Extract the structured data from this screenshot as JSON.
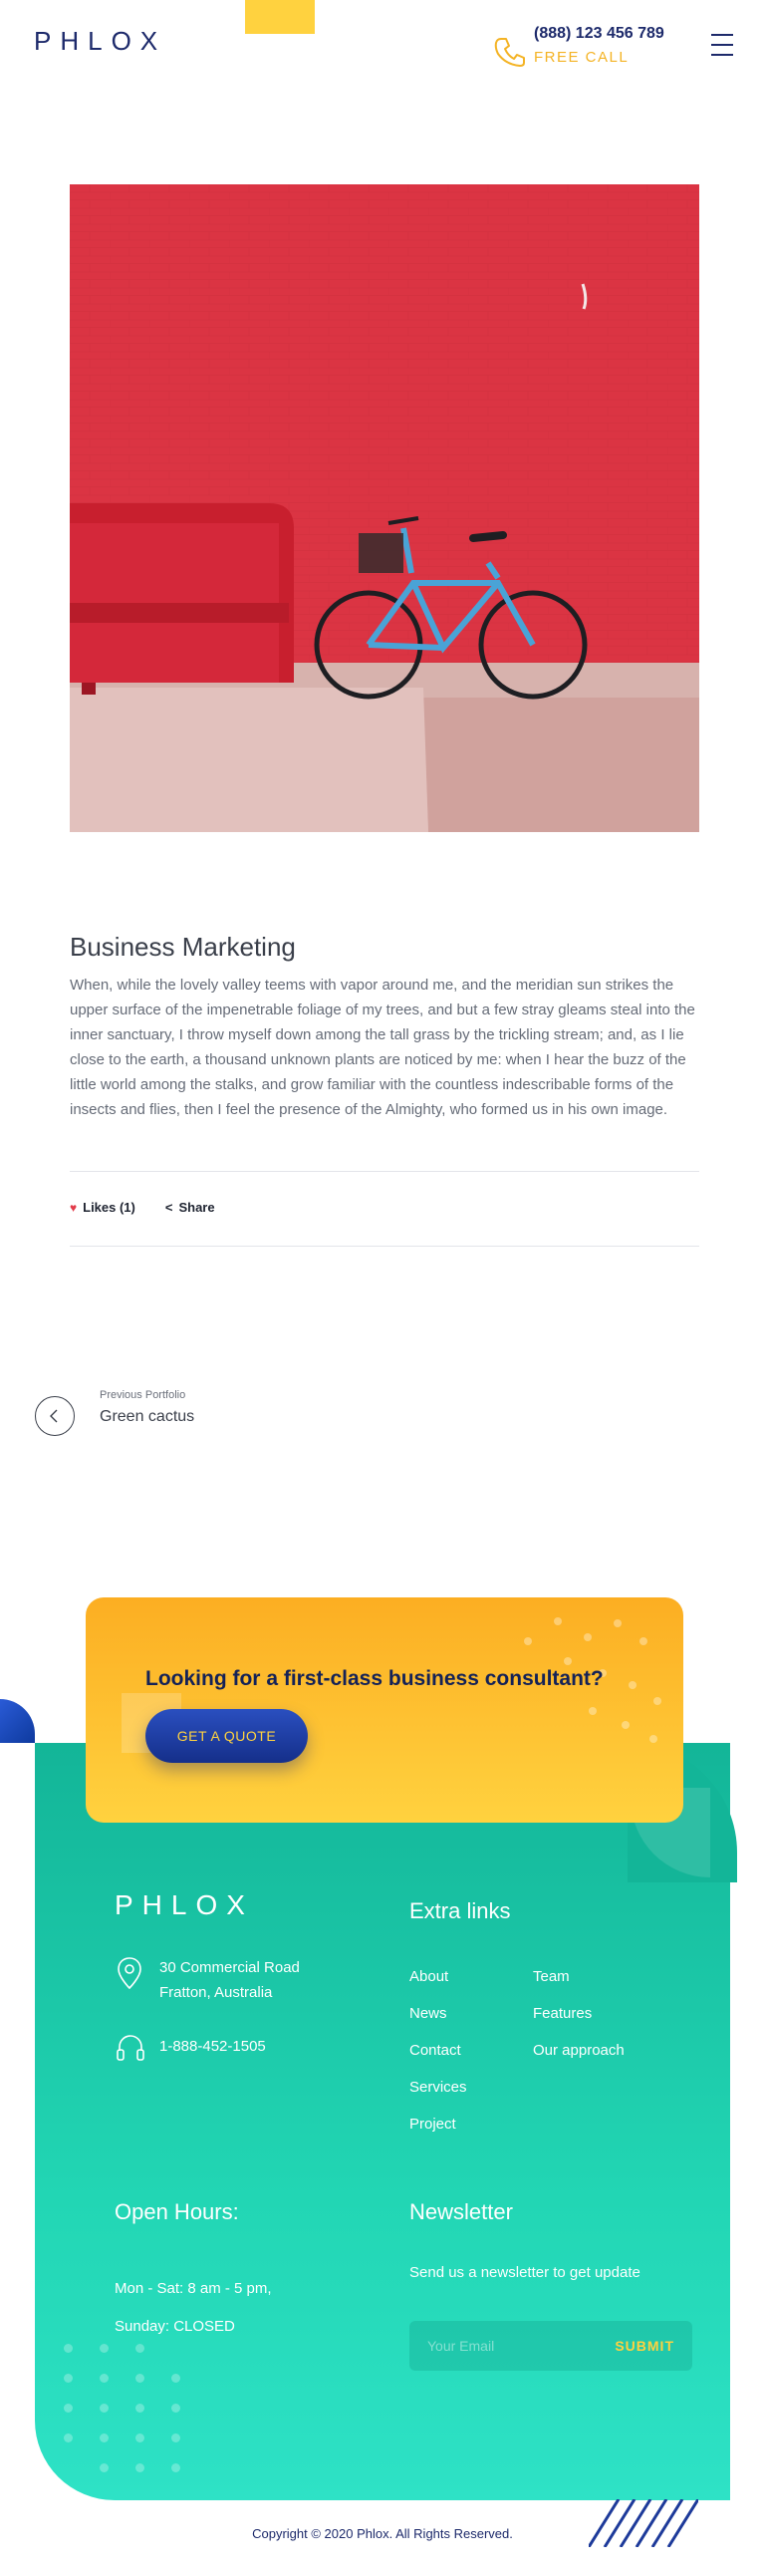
{
  "header": {
    "logo": "PHLOX",
    "phone_number": "(888) 123 456 789",
    "free_call": "FREE CALL",
    "menu_icon": "hamburger-menu-icon",
    "phone_icon": "phone-icon"
  },
  "article": {
    "title": "Business Marketing",
    "body": "When, while the lovely valley teems with vapor around me, and the meridian sun strikes the upper surface of the impenetrable foliage of my trees, and but a few stray gleams steal into the inner sanctuary, I throw myself down among the tall grass by the trickling stream; and, as I lie close to the earth, a thousand unknown plants are noticed by me: when I hear the buzz of the little world among the stalks, and grow familiar with the countless indescribable forms of the insects and flies, then I feel the presence of the Almighty, who formed us in his own image.",
    "likes_label": "Likes (1)",
    "share_label": "Share"
  },
  "previous": {
    "label": "Previous Portfolio",
    "title": "Green cactus"
  },
  "cta": {
    "title": "Looking for a first-class business consultant?",
    "button": "GET A QUOTE"
  },
  "footer": {
    "logo": "PHLOX",
    "address_line1": "30 Commercial Road",
    "address_line2": "Fratton, Australia",
    "phone": "1-888-452-1505",
    "extra_links_title": "Extra links",
    "extra_links_col1": [
      "About",
      "News",
      "Contact",
      "Services",
      "Project"
    ],
    "extra_links_col2": [
      "Team",
      "Features",
      "Our approach"
    ],
    "hours_title": "Open Hours:",
    "hours_line1": "Mon - Sat: 8 am - 5 pm,",
    "hours_line2": "Sunday: CLOSED",
    "newsletter_title": "Newsletter",
    "newsletter_text": "Send us a newsletter to get update",
    "email_placeholder": "Your Email",
    "submit_label": "SUBMIT",
    "copyright": "Copyright © 2020 Phlox. All Rights Reserved."
  },
  "colors": {
    "brand_navy": "#1d2a6b",
    "accent_yellow": "#ffd23f",
    "accent_orange": "#fcae22",
    "teal": "#13b598"
  }
}
